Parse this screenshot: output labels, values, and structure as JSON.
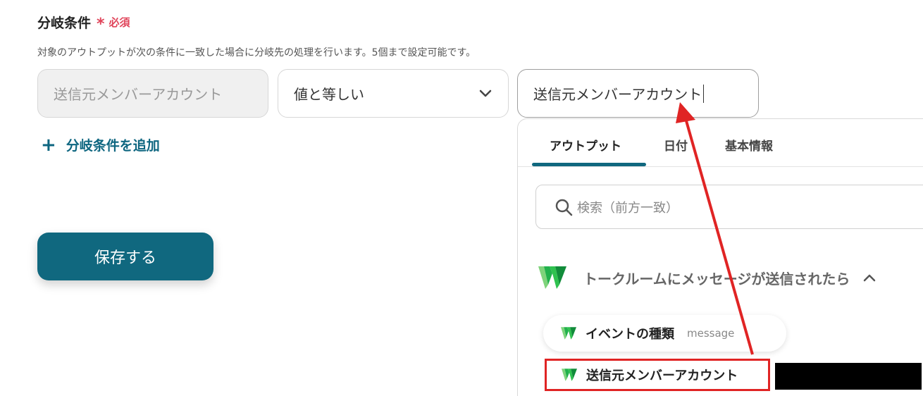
{
  "section": {
    "title": "分岐条件",
    "required_mark": "*",
    "required_label": "必須",
    "description": "対象のアウトプットが次の条件に一致した場合に分岐先の処理を行います。5個まで設定可能です。"
  },
  "condition": {
    "field_value": "送信元メンバーアカウント",
    "operator_value": "値と等しい",
    "input_value": "送信元メンバーアカウント"
  },
  "actions": {
    "add_condition_label": "分岐条件を追加",
    "add_icon": "+",
    "save_label": "保存する"
  },
  "picker": {
    "tabs": [
      "アウトプット",
      "日付",
      "基本情報"
    ],
    "active_tab": "アウトプット",
    "search_placeholder": "検索（前方一致）",
    "group_title": "トークルームにメッセージが送信されたら",
    "items": [
      {
        "name": "イベントの種類",
        "value": "message"
      },
      {
        "name": "送信元メンバーアカウント",
        "value": ""
      }
    ]
  },
  "colors": {
    "accent": "#10687f",
    "required": "#e0445a",
    "highlight_red": "#e02424",
    "logo_green": "#22b14c"
  },
  "icons": {
    "add": "plus-icon",
    "dropdown": "chevron-down-icon",
    "search": "search-icon",
    "group_toggle": "chevron-up-icon",
    "app_logo": "lineworks-logo-icon"
  }
}
